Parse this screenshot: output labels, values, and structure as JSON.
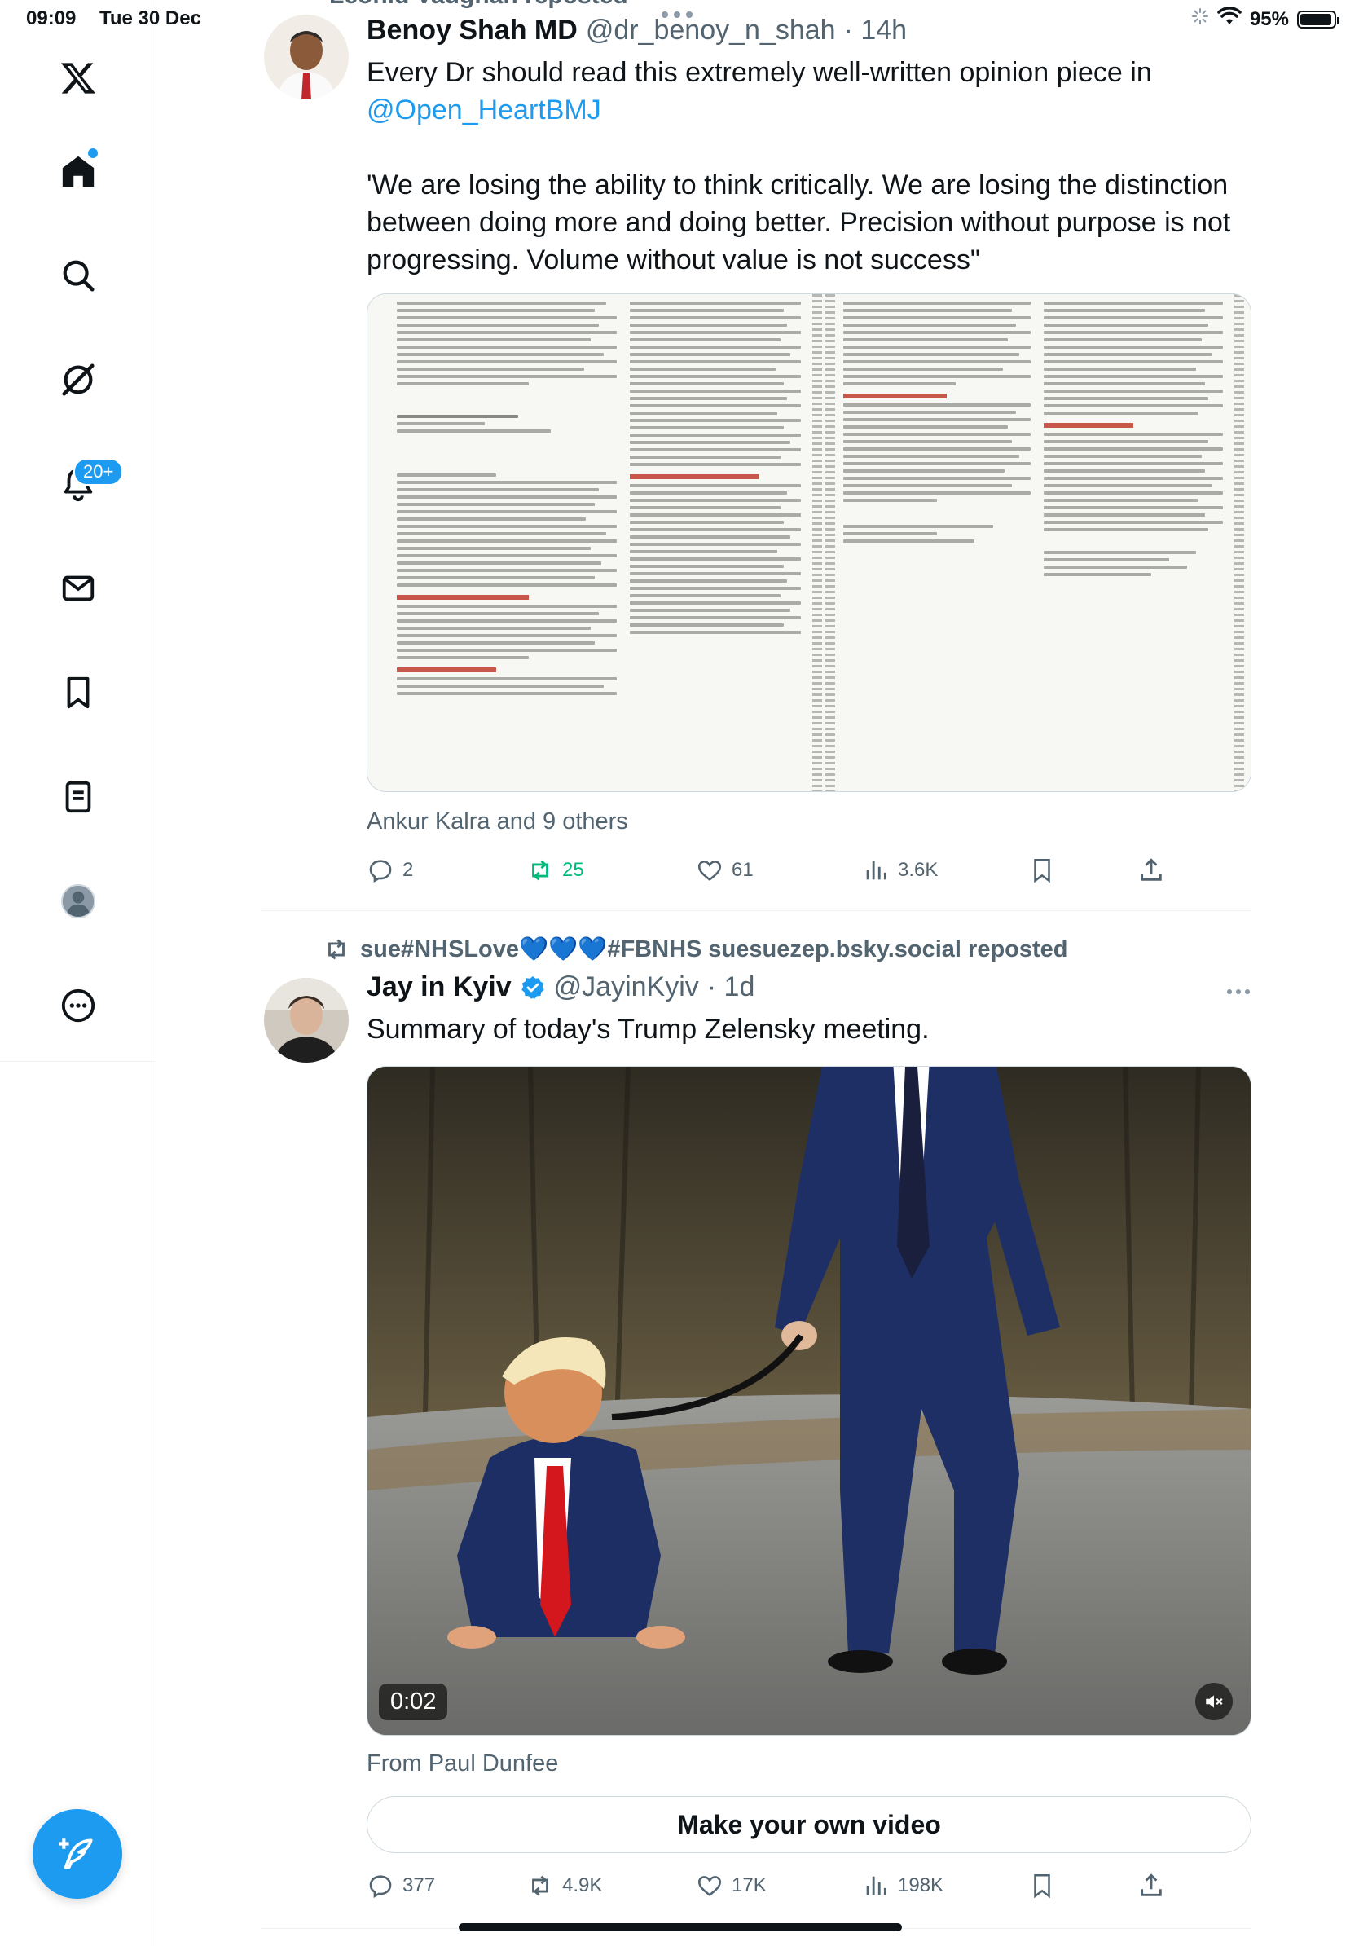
{
  "status_bar": {
    "time": "09:09",
    "date": "Tue 30 Dec",
    "battery": "95%",
    "battery_level": 0.95
  },
  "sidebar": {
    "items": [
      {
        "name": "x-logo-icon"
      },
      {
        "name": "home-icon"
      },
      {
        "name": "search-icon"
      },
      {
        "name": "grok-icon"
      },
      {
        "name": "notifications-icon",
        "badge": "20+"
      },
      {
        "name": "messages-icon"
      },
      {
        "name": "bookmarks-icon"
      },
      {
        "name": "lists-icon"
      },
      {
        "name": "profile-icon"
      },
      {
        "name": "more-icon"
      }
    ],
    "compose_icon": "compose-icon"
  },
  "tweets": [
    {
      "reposted_header": "Leonid Vaughan reposted",
      "author_name": "Benoy Shah MD",
      "handle": "@dr_benoy_n_shah",
      "time": "· 14h",
      "text_intro": "Every Dr should read this extremely well-written opinion piece in",
      "mention": "@Open_HeartBMJ",
      "quote": "'We are losing the ability to think critically. We are losing the distinction between doing more and doing better. Precision without purpose is not progressing. Volume without value is not success\"",
      "social_context": "Ankur Kalra and 9 others",
      "replies": "2",
      "reposts": "25",
      "likes": "61",
      "views": "3.6K"
    },
    {
      "reposted_header": "sue#NHSLove💙💙💙#FBNHS suesuezep.bsky.social reposted",
      "author_name": "Jay in Kyiv",
      "handle": "@JayinKyiv",
      "time": "· 1d",
      "text": "Summary of today's Trump Zelensky meeting.",
      "video_time": "0:02",
      "source": "From Paul Dunfee",
      "make_video_label": "Make your own video",
      "replies": "377",
      "reposts": "4.9K",
      "likes": "17K",
      "views": "198K"
    }
  ],
  "colors": {
    "accent": "#1d9bf0",
    "repost_green": "#00ba7c",
    "secondary_text": "#536471"
  }
}
